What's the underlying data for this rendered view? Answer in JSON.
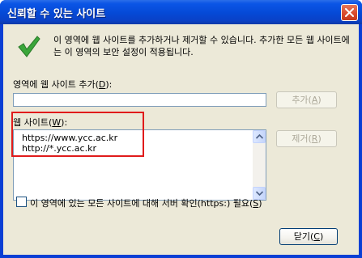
{
  "window": {
    "title": "신뢰할 수 있는 사이트"
  },
  "intro": {
    "text": "이 영역에 웹 사이트를 추가하거나 제거할 수 있습니다. 추가한 모든 웹 사이트에는 이 영역의 보안 설정이 적용됩니다."
  },
  "add": {
    "label_prefix": "영역에 웹 사이트 추가(",
    "label_key": "D",
    "label_suffix": "):",
    "input_value": "",
    "button_prefix": "추가(",
    "button_key": "A",
    "button_suffix": ")"
  },
  "sites": {
    "label_prefix": "웹 사이트(",
    "label_key": "W",
    "label_suffix": "):",
    "items": [
      "https://www.ycc.ac.kr",
      "http://*.ycc.ac.kr"
    ],
    "remove_prefix": "제거(",
    "remove_key": "R",
    "remove_suffix": ")"
  },
  "https_option": {
    "label_prefix": "이 영역에 있는 모든 사이트에 대해 서버 확인(https:) 필요(",
    "label_key": "S",
    "label_suffix": ")",
    "checked": false
  },
  "footer": {
    "close_prefix": "닫기(",
    "close_key": "C",
    "close_suffix": ")"
  },
  "icons": {
    "check": "green-checkmark-icon",
    "close": "close-x-icon",
    "scroll_up": "scroll-up-arrow-icon",
    "scroll_down": "scroll-down-arrow-icon"
  },
  "colors": {
    "title_bar": "#0549d6",
    "dialog_bg": "#ece9d8",
    "highlight": "#e01b1b",
    "check": "#3aa63a"
  }
}
